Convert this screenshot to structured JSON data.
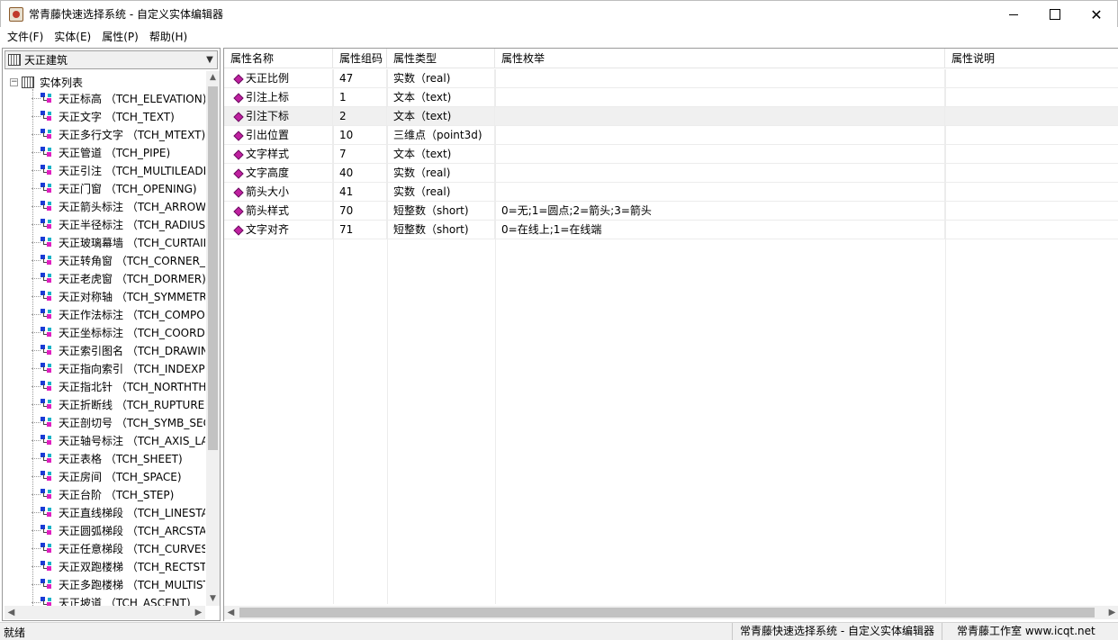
{
  "window": {
    "title": "常青藤快速选择系统 - 自定义实体编辑器"
  },
  "menu": [
    "文件(F)",
    "实体(E)",
    "属性(P)",
    "帮助(H)"
  ],
  "left": {
    "combo_value": "天正建筑",
    "root_label": "实体列表",
    "items": [
      "天正标高 （TCH_ELEVATION)",
      "天正文字 （TCH_TEXT)",
      "天正多行文字 （TCH_MTEXT)",
      "天正管道 （TCH_PIPE)",
      "天正引注 （TCH_MULTILEADE",
      "天正门窗 （TCH_OPENING)",
      "天正箭头标注 （TCH_ARROW)",
      "天正半径标注 （TCH_RADIUSD",
      "天正玻璃幕墙 （TCH_CURTAIN",
      "天正转角窗 （TCH_CORNER_W",
      "天正老虎窗 （TCH_DORMER)",
      "天正对称轴 （TCH_SYMMETR",
      "天正作法标注 （TCH_COMPO",
      "天正坐标标注 （TCH_COORD)",
      "天正索引图名 （TCH_DRAWIN",
      "天正指向索引 （TCH_INDEXPO",
      "天正指北针 （TCH_NORTHTH",
      "天正折断线 （TCH_RUPTURE)",
      "天正剖切号 （TCH_SYMB_SEC",
      "天正轴号标注 （TCH_AXIS_LA",
      "天正表格 （TCH_SHEET)",
      "天正房间 （TCH_SPACE)",
      "天正台阶 （TCH_STEP)",
      "天正直线梯段 （TCH_LINESTA",
      "天正圆弧梯段 （TCH_ARCSTAI",
      "天正任意梯段 （TCH_CURVEST",
      "天正双跑楼梯 （TCH_RECTSTA",
      "天正多跑楼梯 （TCH_MULTIST",
      "天正坡道 （TCH_ASCENT)"
    ]
  },
  "grid": {
    "headers": [
      "属性名称",
      "属性组码",
      "属性类型",
      "属性枚举",
      "属性说明"
    ],
    "rows": [
      {
        "name": "天正比例",
        "code": "47",
        "type": "实数（real)",
        "enum": "",
        "desc": ""
      },
      {
        "name": "引注上标",
        "code": "1",
        "type": "文本（text)",
        "enum": "",
        "desc": ""
      },
      {
        "name": "引注下标",
        "code": "2",
        "type": "文本（text)",
        "enum": "",
        "desc": ""
      },
      {
        "name": "引出位置",
        "code": "10",
        "type": "三维点（point3d)",
        "enum": "",
        "desc": ""
      },
      {
        "name": "文字样式",
        "code": "7",
        "type": "文本（text)",
        "enum": "",
        "desc": ""
      },
      {
        "name": "文字高度",
        "code": "40",
        "type": "实数（real)",
        "enum": "",
        "desc": ""
      },
      {
        "name": "箭头大小",
        "code": "41",
        "type": "实数（real)",
        "enum": "",
        "desc": ""
      },
      {
        "name": "箭头样式",
        "code": "70",
        "type": "短整数（short)",
        "enum": "0=无;1=圆点;2=箭头;3=箭头",
        "desc": ""
      },
      {
        "name": "文字对齐",
        "code": "71",
        "type": "短整数（short)",
        "enum": "0=在线上;1=在线端",
        "desc": ""
      }
    ]
  },
  "status": {
    "left": "就绪",
    "mid": "常青藤快速选择系统 - 自定义实体编辑器",
    "right": "常青藤工作室 www.icqt.net"
  }
}
